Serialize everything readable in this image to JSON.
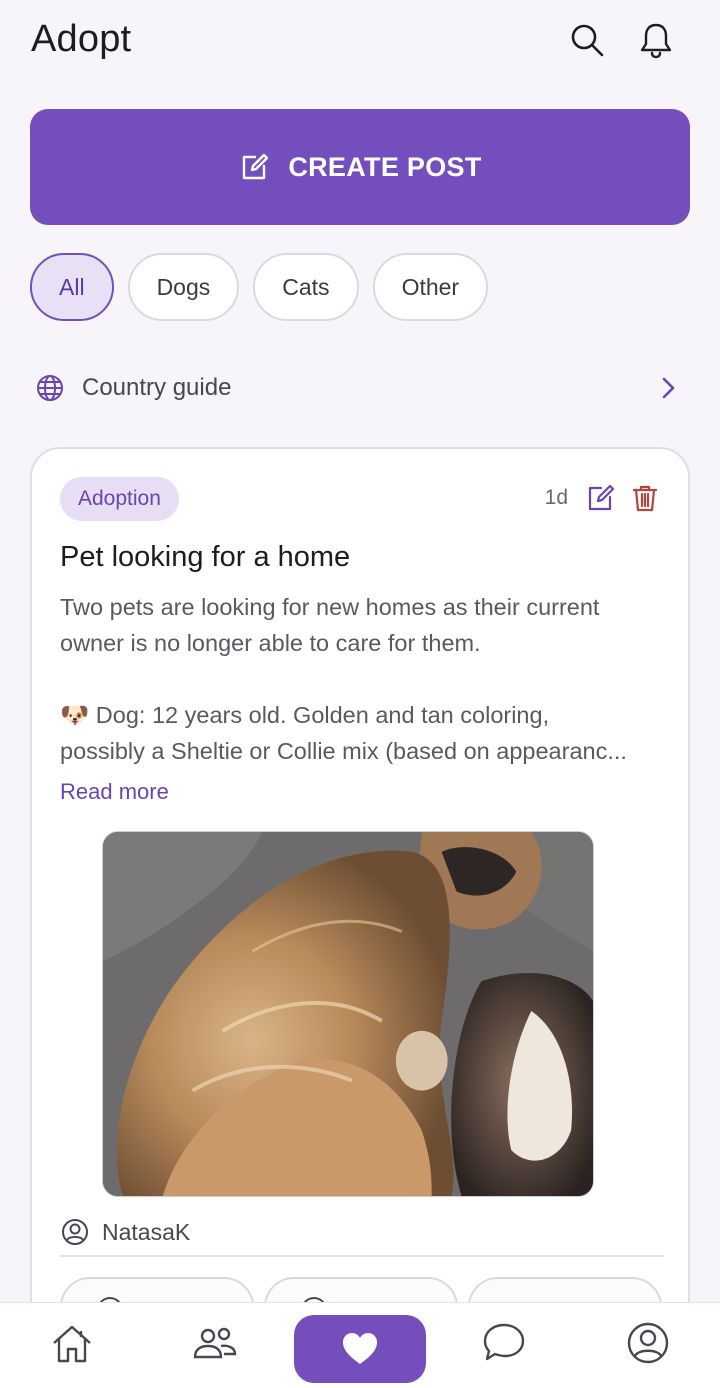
{
  "header": {
    "title": "Adopt",
    "icons": [
      "search-icon",
      "bell-icon"
    ]
  },
  "create_post": {
    "label": "CREATE POST",
    "icon": "edit-icon"
  },
  "filters": [
    {
      "label": "All",
      "active": true
    },
    {
      "label": "Dogs",
      "active": false
    },
    {
      "label": "Cats",
      "active": false
    },
    {
      "label": "Other",
      "active": false
    }
  ],
  "country_guide": {
    "label": "Country guide",
    "icon": "globe-icon"
  },
  "post": {
    "badge": "Adoption",
    "age": "1d",
    "title": "Pet looking for a home",
    "body_lines": [
      "Two pets are looking for new homes as their current",
      "owner is no longer able to care for them.",
      "🐶 Dog: 12 years old. Golden and tan coloring,",
      "possibly a Sheltie or Collie mix (based on appearanc..."
    ],
    "read_more": "Read more",
    "author": "NatasaK"
  },
  "bottom_nav": [
    "home-icon",
    "community-icon",
    "heart-icon",
    "chat-icon",
    "profile-icon"
  ],
  "colors": {
    "accent": "#744ebd",
    "accent_light": "#e7def5",
    "background": "#f7f5fa",
    "delete": "#b3443f"
  }
}
